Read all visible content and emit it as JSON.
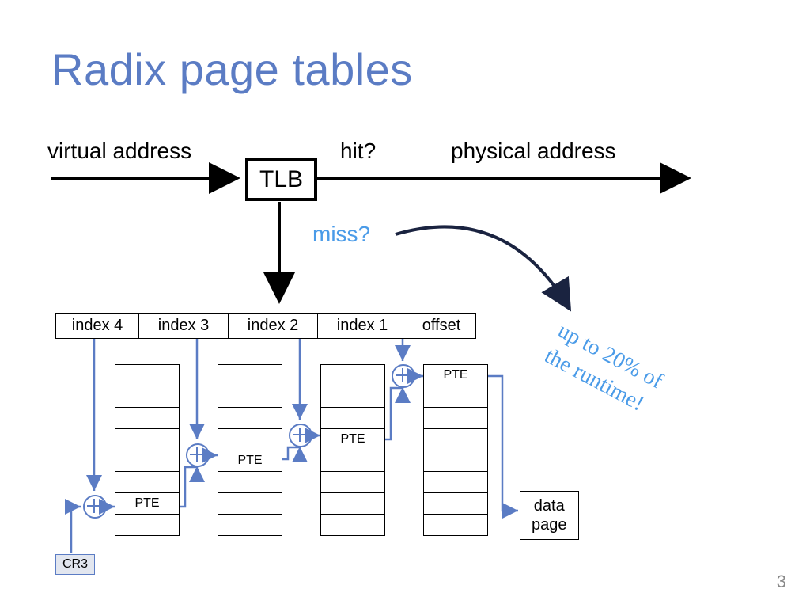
{
  "title": "Radix page tables",
  "labels": {
    "virtual_address": "virtual address",
    "hit": "hit?",
    "physical_address": "physical address",
    "miss": "miss?",
    "tlb": "TLB"
  },
  "index_cells": [
    "index 4",
    "index 3",
    "index 2",
    "index 1",
    "offset"
  ],
  "pte_label": "PTE",
  "cr3": "CR3",
  "data_page": "data\npage",
  "handwritten": "up to 20% of\nthe runtime!",
  "page_number": "3",
  "colors": {
    "title": "#5b7cc4",
    "accent_blue": "#4a9be8",
    "arrow_blue": "#5b7cc4",
    "dark_navy": "#1a2340"
  }
}
